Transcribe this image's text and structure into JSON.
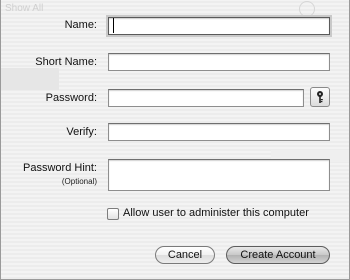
{
  "form": {
    "name_label": "Name:",
    "name_value": "",
    "short_name_label": "Short Name:",
    "short_name_value": "",
    "password_label": "Password:",
    "password_value": "",
    "verify_label": "Verify:",
    "verify_value": "",
    "hint_label": "Password Hint:",
    "hint_sublabel": "(Optional)",
    "hint_value": "",
    "admin_checkbox_label": "Allow user to administer this computer",
    "admin_checked": false
  },
  "buttons": {
    "cancel": "Cancel",
    "create": "Create Account"
  },
  "background": {
    "show_all": "Show All"
  },
  "icons": {
    "password_assistant": "key-icon"
  }
}
